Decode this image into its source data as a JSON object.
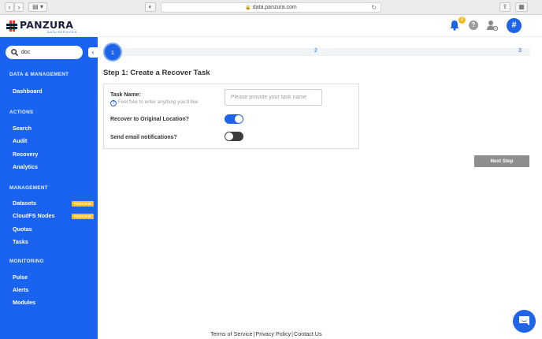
{
  "browser": {
    "url": "data.panzura.com"
  },
  "header": {
    "logo_text": "PANZURA",
    "logo_subtext": "DATA SERVICES",
    "notification_count": "2",
    "help_label": "?",
    "avatar_label": "#"
  },
  "sidebar": {
    "search_value": "doc",
    "collapse_label": "‹",
    "sections": {
      "data_management": "DATA & MANAGEMENT",
      "actions": "ACTIONS",
      "management": "MANAGEMENT",
      "monitoring": "MONITORING"
    },
    "items": {
      "dashboard": "Dashboard",
      "search": "Search",
      "audit": "Audit",
      "recovery": "Recovery",
      "analytics": "Analytics",
      "datasets": "Datasets",
      "cloudfs_nodes": "CloudFS Nodes",
      "quotas": "Quotas",
      "tasks": "Tasks",
      "pulse": "Pulse",
      "alerts": "Alerts",
      "modules": "Modules"
    },
    "preview_badge": "PREVIEW"
  },
  "wizard": {
    "steps": [
      "1",
      "2",
      "3"
    ],
    "current_step": 1,
    "title": "Step 1: Create a Recover Task",
    "task_name_label": "Task Name:",
    "task_name_hint": "Feel free to enter anything you'd like",
    "task_name_placeholder": "Please provide your task name",
    "task_name_value": "",
    "recover_original_label": "Recover to Original Location?",
    "recover_original_on": true,
    "email_notifications_label": "Send email notifications?",
    "email_notifications_on": false,
    "next_button": "Next Step"
  },
  "footer": {
    "terms": "Terms of Service",
    "privacy": "Privacy Policy",
    "contact": "Contact Us",
    "separator": "|"
  },
  "colors": {
    "primary": "#1f63e6",
    "sidebar": "#1a63f0",
    "badge": "#f4c020",
    "disabled_button": "#8e8e8e"
  }
}
